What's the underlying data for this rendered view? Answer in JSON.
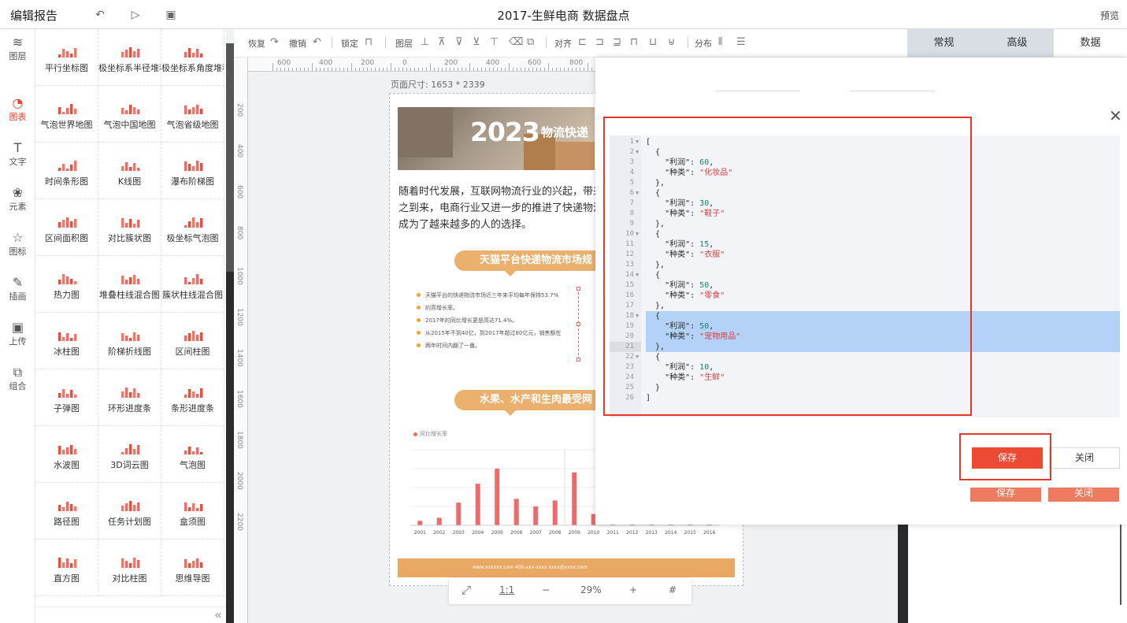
{
  "app": {
    "title": "编辑报告",
    "doc_title": "2017-生鲜电商 数据盘点",
    "preview": "预览"
  },
  "colors": {
    "accent": "#e5432d",
    "save_button": "#ec4a32",
    "pill": "#ebb06d",
    "bar": "#ec6b6b"
  },
  "leftnav": [
    {
      "label": "图层",
      "icon": "layers-icon",
      "glyph": "≋"
    },
    {
      "label": "图表",
      "icon": "pie-chart-icon",
      "glyph": "◔"
    },
    {
      "label": "文字",
      "icon": "text-icon",
      "glyph": "T"
    },
    {
      "label": "元素",
      "icon": "elements-icon",
      "glyph": "❀"
    },
    {
      "label": "图标",
      "icon": "star-icon",
      "glyph": "☆"
    },
    {
      "label": "插画",
      "icon": "palette-icon",
      "glyph": "✎"
    },
    {
      "label": "上传",
      "icon": "image-upload-icon",
      "glyph": "▣"
    },
    {
      "label": "组合",
      "icon": "group-icon",
      "glyph": "⧉"
    }
  ],
  "charts": [
    "平行坐标图",
    "极坐标系半径堆积",
    "极坐标系角度堆积",
    "气泡世界地图",
    "气泡中国地图",
    "气泡省级地图",
    "时间条形图",
    "K线图",
    "瀑布阶梯图",
    "区间面积图",
    "对比簇状图",
    "极坐标气泡图",
    "热力图",
    "堆叠柱线混合图",
    "簇状柱线混合图",
    "冰柱图",
    "阶梯折线图",
    "区间柱图",
    "子弹图",
    "环形进度条",
    "条形进度条",
    "水波图",
    "3D词云图",
    "气泡图",
    "路径图",
    "任务计划图",
    "盒须图",
    "直方图",
    "对比柱图",
    "思维导图"
  ],
  "toolbar": {
    "redo": "恢复",
    "undo": "撤销",
    "lock": "锁定",
    "layer": "图层",
    "align": "对齐",
    "distribute": "分布"
  },
  "ruler_ticks": [
    "600",
    "400",
    "200",
    "0",
    "200",
    "400",
    "600",
    "800"
  ],
  "ruler_v_ticks": [
    "200",
    "400",
    "600",
    "800",
    "1000",
    "1200",
    "1400",
    "1600",
    "1800",
    "2000",
    "2200"
  ],
  "canvas": {
    "page_size": "页面尺寸: 1653 * 2339",
    "banner_year": "2023",
    "banner_sub": "物流快递",
    "intro": [
      "随着时代发展，互联网物流行业的兴起，带来",
      "之到来，电商行业又进一步的推进了快递物流",
      "成为了越来越多的人的选择。"
    ],
    "pill1": "天猫平台快递物流市场规",
    "bullets": [
      "天猫平台的快递物流市场近三年来平均每年保持53.7%",
      "的高增长率。",
      "2017年的同比增长更是高达71.4%。",
      "从2015年不到40亿，到2017年超过80亿元，销售额在",
      "两年时间内翻了一番。"
    ],
    "pill2": "水果、水产和生肉最受网",
    "legend": "同比增长率",
    "footer_text": "www.xxxxxx.com   400-xxx-xxxx   xxxx@xxxx.com"
  },
  "chart_data": {
    "type": "bar",
    "categories": [
      "2001",
      "2002",
      "2003",
      "2004",
      "2005",
      "2006",
      "2007",
      "2008",
      "2009",
      "2010",
      "2011",
      "2012",
      "2013",
      "2014",
      "2015",
      "2016"
    ],
    "values": [
      6,
      10,
      30,
      55,
      75,
      35,
      25,
      33,
      70,
      15,
      12,
      10,
      15,
      12,
      15,
      16
    ],
    "ylim": [
      0,
      100
    ]
  },
  "zoom": {
    "fit": "⤢",
    "ratio": "1:1",
    "minus": "−",
    "percent": "29%",
    "plus": "+",
    "grid": "#"
  },
  "tabs": [
    "常规",
    "高级",
    "数据"
  ],
  "editor": {
    "lines": [
      {
        "n": "1",
        "fold": true,
        "t": [
          [
            "k",
            "["
          ]
        ]
      },
      {
        "n": "2",
        "fold": true,
        "t": [
          [
            "k",
            "  {"
          ]
        ]
      },
      {
        "n": "3",
        "t": [
          [
            "k",
            "    \"利润\": "
          ],
          [
            "n",
            "60"
          ],
          [
            "k",
            ","
          ]
        ]
      },
      {
        "n": "4",
        "t": [
          [
            "k",
            "    \"种类\": "
          ],
          [
            "s",
            "\"化妆品\""
          ]
        ]
      },
      {
        "n": "5",
        "t": [
          [
            "k",
            "  },"
          ]
        ]
      },
      {
        "n": "6",
        "fold": true,
        "t": [
          [
            "k",
            "  {"
          ]
        ]
      },
      {
        "n": "7",
        "t": [
          [
            "k",
            "    \"利润\": "
          ],
          [
            "n",
            "30"
          ],
          [
            "k",
            ","
          ]
        ]
      },
      {
        "n": "8",
        "t": [
          [
            "k",
            "    \"种类\": "
          ],
          [
            "s",
            "\"鞋子\""
          ]
        ]
      },
      {
        "n": "9",
        "t": [
          [
            "k",
            "  },"
          ]
        ]
      },
      {
        "n": "10",
        "fold": true,
        "t": [
          [
            "k",
            "  {"
          ]
        ]
      },
      {
        "n": "11",
        "t": [
          [
            "k",
            "    \"利润\": "
          ],
          [
            "n",
            "15"
          ],
          [
            "k",
            ","
          ]
        ]
      },
      {
        "n": "12",
        "t": [
          [
            "k",
            "    \"种类\": "
          ],
          [
            "s",
            "\"衣服\""
          ]
        ]
      },
      {
        "n": "13",
        "t": [
          [
            "k",
            "  },"
          ]
        ]
      },
      {
        "n": "14",
        "fold": true,
        "t": [
          [
            "k",
            "  {"
          ]
        ]
      },
      {
        "n": "15",
        "t": [
          [
            "k",
            "    \"利润\": "
          ],
          [
            "n",
            "50"
          ],
          [
            "k",
            ","
          ]
        ]
      },
      {
        "n": "16",
        "t": [
          [
            "k",
            "    \"种类\": "
          ],
          [
            "s",
            "\"零食\""
          ]
        ]
      },
      {
        "n": "17",
        "t": [
          [
            "k",
            "  },"
          ]
        ]
      },
      {
        "n": "18",
        "fold": true,
        "hl": true,
        "t": [
          [
            "k",
            "  {"
          ]
        ]
      },
      {
        "n": "19",
        "hl": true,
        "t": [
          [
            "k",
            "    \"利润\": "
          ],
          [
            "n",
            "50"
          ],
          [
            "k",
            ","
          ]
        ]
      },
      {
        "n": "20",
        "hl": true,
        "t": [
          [
            "k",
            "    \"种类\": "
          ],
          [
            "s",
            "\"宠物用品\""
          ]
        ]
      },
      {
        "n": "21",
        "hl": true,
        "t": [
          [
            "k",
            "  },"
          ]
        ]
      },
      {
        "n": "22",
        "fold": true,
        "t": [
          [
            "k",
            "  {"
          ]
        ]
      },
      {
        "n": "23",
        "t": [
          [
            "k",
            "    \"利润\": "
          ],
          [
            "n",
            "10"
          ],
          [
            "k",
            ","
          ]
        ]
      },
      {
        "n": "24",
        "t": [
          [
            "k",
            "    \"种类\": "
          ],
          [
            "s",
            "\"生鲜\""
          ]
        ]
      },
      {
        "n": "25",
        "t": [
          [
            "k",
            "  }"
          ]
        ]
      },
      {
        "n": "26",
        "t": [
          [
            "k",
            "]"
          ]
        ]
      }
    ]
  },
  "dialog": {
    "save": "保存",
    "close": "关闭",
    "close_x": "✕"
  }
}
